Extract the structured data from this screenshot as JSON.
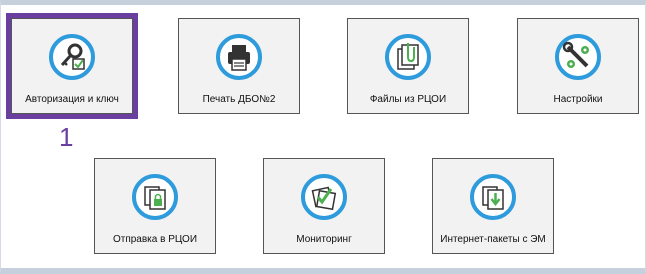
{
  "accent_color": "#2e9bdc",
  "selection_color": "#6b3fa0",
  "annotation": "1",
  "row1": [
    {
      "label": "Авторизация и ключ",
      "icon": "key-check-icon",
      "selected": true
    },
    {
      "label": "Печать ДБО№2",
      "icon": "printer-icon",
      "selected": false
    },
    {
      "label": "Файлы из РЦОИ",
      "icon": "attachment-files-icon",
      "selected": false
    },
    {
      "label": "Настройки",
      "icon": "wrench-gear-icon",
      "selected": false
    }
  ],
  "row2": [
    {
      "label": "Отправка в РЦОИ",
      "icon": "send-files-lock-icon",
      "selected": false
    },
    {
      "label": "Мониторинг",
      "icon": "monitoring-check-icon",
      "selected": false
    },
    {
      "label": "Интернет-пакеты с ЭМ",
      "icon": "download-package-icon",
      "selected": false
    }
  ]
}
